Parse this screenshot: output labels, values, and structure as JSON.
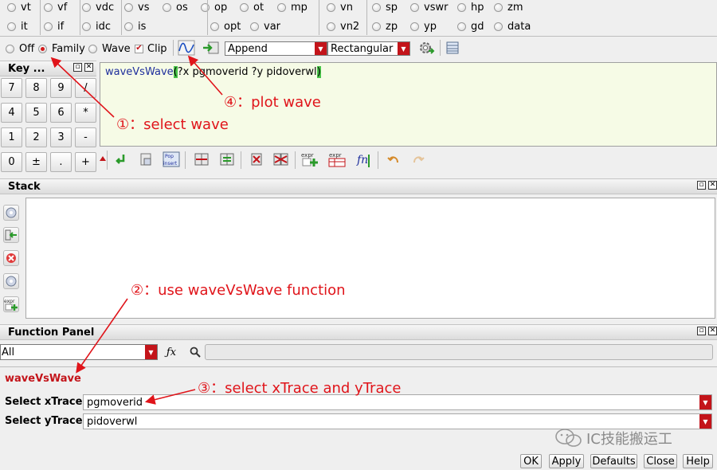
{
  "radio_row1": [
    "vt",
    "vf",
    "vdc",
    "vs",
    "os",
    "op",
    "ot",
    "mp",
    "vn",
    "sp",
    "vswr",
    "hp",
    "zm"
  ],
  "radio_row2": [
    "it",
    "if",
    "idc",
    "is",
    "opt",
    "var",
    "vn2",
    "zp",
    "yp",
    "gd",
    "data"
  ],
  "toolbar": {
    "mode_off": "Off",
    "mode_family": "Family",
    "mode_wave": "Wave",
    "clip": "Clip",
    "append": "Append",
    "rectangular": "Rectangular"
  },
  "key_panel": {
    "title": "Key ...",
    "keys": [
      "7",
      "8",
      "9",
      "/",
      "4",
      "5",
      "6",
      "*",
      "1",
      "2",
      "3",
      "-",
      "0",
      "±",
      ".",
      "+"
    ]
  },
  "buffer": {
    "func": "waveVsWave",
    "args": "?x pgmoverid ?y pidoverwl",
    "open_paren": "(",
    "close_paren": ")"
  },
  "stack": {
    "title": "Stack"
  },
  "function_panel": {
    "title": "Function Panel",
    "category": "All",
    "function_name": "waveVsWave",
    "xtrace_label": "Select xTrace",
    "xtrace_value": "pgmoverid",
    "ytrace_label": "Select yTrace",
    "ytrace_value": "pidoverwl"
  },
  "buttons": {
    "ok": "OK",
    "apply": "Apply",
    "defaults": "Defaults",
    "close": "Close",
    "help": "Help"
  },
  "annotations": {
    "a1": "①：select wave",
    "a2": "②：use waveVsWave function",
    "a3": "③：select xTrace and yTrace",
    "a4": "④：plot wave"
  },
  "watermark": "IC技能搬运工",
  "colors": {
    "accent": "#c3141a",
    "annotation": "#e0141a",
    "buffer_bg": "#f6fbe6"
  }
}
